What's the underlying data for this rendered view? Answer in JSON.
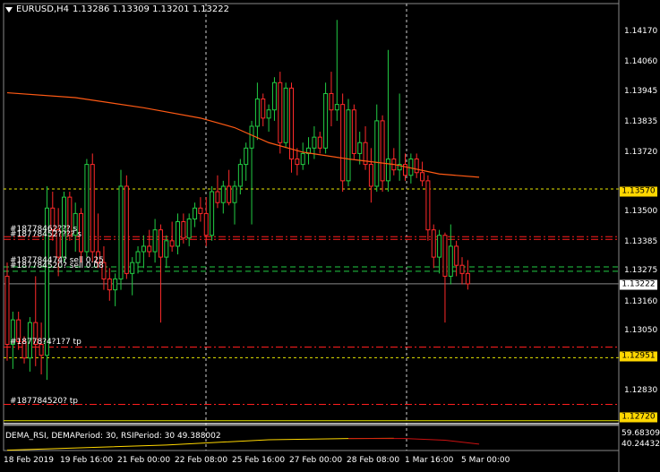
{
  "header": {
    "symbol_timeframe": "EURUSD,H4",
    "ohlc": "1.13286 1.13309 1.13201 1.13222"
  },
  "colors": {
    "background": "#000000",
    "grid": "#3c3c3c",
    "bull_candle": "#22cc44",
    "bear_candle": "#ff2a2a",
    "ma_line": "#ff5a14",
    "bid_line": "#888888",
    "tp_line": "#ff1e1e",
    "entry_line": "#22cc44",
    "level_line": "#e8e800",
    "rsi_yellow": "#ffd700",
    "rsi_red": "#cc1111"
  },
  "price_axis": {
    "ticks": [
      "1.14170",
      "1.14060",
      "1.13945",
      "1.13835",
      "1.13720",
      "1.13500",
      "1.13385",
      "1.13275",
      "1.13160",
      "1.13050",
      "1.12830"
    ],
    "current_price_tag": "1.13222",
    "level_tags": [
      "1.13570",
      "1.12951",
      "1.12720"
    ]
  },
  "orders": {
    "labels": [
      "#18778462??? s",
      "#18778452???? s",
      "#187784474? sell 0.25",
      "#187784520? sell 0.08",
      "#18778?4?1?7 tp",
      "#187784520? tp"
    ]
  },
  "time_axis": {
    "labels": [
      "18 Feb 2019",
      "19 Feb 16:00",
      "21 Feb 00:00",
      "22 Feb 08:00",
      "25 Feb 16:00",
      "27 Feb 00:00",
      "28 Feb 08:00",
      "1 Mar 16:00",
      "5 Mar 00:00"
    ]
  },
  "indicator": {
    "title": "DEMA_RSI, DEMAPeriod: 30, RSIPeriod: 30  49.388002",
    "ticks": [
      "59.683093",
      "40.244323"
    ]
  },
  "chart_data": {
    "type": "candlestick",
    "symbol": "EURUSD",
    "timeframe": "H4",
    "ylim": [
      1.12706,
      1.1425
    ],
    "ohlc": [
      {
        "o": 1.1325,
        "h": 1.133,
        "l": 1.1294,
        "c": 1.13
      },
      {
        "o": 1.13,
        "h": 1.1312,
        "l": 1.1291,
        "c": 1.1309
      },
      {
        "o": 1.1309,
        "h": 1.1312,
        "l": 1.1298,
        "c": 1.1301
      },
      {
        "o": 1.1301,
        "h": 1.1303,
        "l": 1.1293,
        "c": 1.1295
      },
      {
        "o": 1.1295,
        "h": 1.131,
        "l": 1.129,
        "c": 1.1308
      },
      {
        "o": 1.1308,
        "h": 1.1325,
        "l": 1.1292,
        "c": 1.13
      },
      {
        "o": 1.13,
        "h": 1.1308,
        "l": 1.1289,
        "c": 1.1296
      },
      {
        "o": 1.1296,
        "h": 1.1358,
        "l": 1.1287,
        "c": 1.135
      },
      {
        "o": 1.135,
        "h": 1.1356,
        "l": 1.1338,
        "c": 1.1342
      },
      {
        "o": 1.1342,
        "h": 1.135,
        "l": 1.1325,
        "c": 1.1332
      },
      {
        "o": 1.1332,
        "h": 1.1356,
        "l": 1.133,
        "c": 1.1354
      },
      {
        "o": 1.1354,
        "h": 1.1356,
        "l": 1.1338,
        "c": 1.134
      },
      {
        "o": 1.134,
        "h": 1.1352,
        "l": 1.1334,
        "c": 1.1348
      },
      {
        "o": 1.1348,
        "h": 1.135,
        "l": 1.133,
        "c": 1.1334
      },
      {
        "o": 1.1334,
        "h": 1.1368,
        "l": 1.1332,
        "c": 1.1366
      },
      {
        "o": 1.1366,
        "h": 1.137,
        "l": 1.133,
        "c": 1.1334
      },
      {
        "o": 1.1334,
        "h": 1.1348,
        "l": 1.1328,
        "c": 1.133
      },
      {
        "o": 1.133,
        "h": 1.1336,
        "l": 1.132,
        "c": 1.1324
      },
      {
        "o": 1.1324,
        "h": 1.1328,
        "l": 1.1316,
        "c": 1.132
      },
      {
        "o": 1.132,
        "h": 1.1326,
        "l": 1.1314,
        "c": 1.1324
      },
      {
        "o": 1.1324,
        "h": 1.1364,
        "l": 1.132,
        "c": 1.1358
      },
      {
        "o": 1.1358,
        "h": 1.1362,
        "l": 1.1324,
        "c": 1.1326
      },
      {
        "o": 1.1326,
        "h": 1.1332,
        "l": 1.1318,
        "c": 1.133
      },
      {
        "o": 1.133,
        "h": 1.1336,
        "l": 1.1326,
        "c": 1.1334
      },
      {
        "o": 1.1334,
        "h": 1.134,
        "l": 1.1328,
        "c": 1.1336
      },
      {
        "o": 1.1336,
        "h": 1.1342,
        "l": 1.1332,
        "c": 1.1334
      },
      {
        "o": 1.1334,
        "h": 1.1346,
        "l": 1.133,
        "c": 1.1342
      },
      {
        "o": 1.1342,
        "h": 1.1344,
        "l": 1.1308,
        "c": 1.1332
      },
      {
        "o": 1.1332,
        "h": 1.134,
        "l": 1.1328,
        "c": 1.1338
      },
      {
        "o": 1.1338,
        "h": 1.1345,
        "l": 1.1334,
        "c": 1.1336
      },
      {
        "o": 1.1336,
        "h": 1.1348,
        "l": 1.1333,
        "c": 1.1345
      },
      {
        "o": 1.1345,
        "h": 1.1348,
        "l": 1.1337,
        "c": 1.1339
      },
      {
        "o": 1.1339,
        "h": 1.1348,
        "l": 1.1336,
        "c": 1.1346
      },
      {
        "o": 1.1346,
        "h": 1.1352,
        "l": 1.1343,
        "c": 1.135
      },
      {
        "o": 1.135,
        "h": 1.1354,
        "l": 1.1345,
        "c": 1.1348
      },
      {
        "o": 1.1348,
        "h": 1.1354,
        "l": 1.1336,
        "c": 1.134
      },
      {
        "o": 1.134,
        "h": 1.1358,
        "l": 1.1338,
        "c": 1.1356
      },
      {
        "o": 1.1356,
        "h": 1.1362,
        "l": 1.135,
        "c": 1.1352
      },
      {
        "o": 1.1352,
        "h": 1.136,
        "l": 1.1348,
        "c": 1.1358
      },
      {
        "o": 1.1358,
        "h": 1.1364,
        "l": 1.1351,
        "c": 1.1352
      },
      {
        "o": 1.1352,
        "h": 1.136,
        "l": 1.1344,
        "c": 1.1358
      },
      {
        "o": 1.1358,
        "h": 1.1368,
        "l": 1.1355,
        "c": 1.1366
      },
      {
        "o": 1.1366,
        "h": 1.1374,
        "l": 1.136,
        "c": 1.1372
      },
      {
        "o": 1.1372,
        "h": 1.1382,
        "l": 1.1344,
        "c": 1.138
      },
      {
        "o": 1.138,
        "h": 1.1396,
        "l": 1.1375,
        "c": 1.139
      },
      {
        "o": 1.139,
        "h": 1.1392,
        "l": 1.138,
        "c": 1.1383
      },
      {
        "o": 1.1383,
        "h": 1.1388,
        "l": 1.1378,
        "c": 1.1386
      },
      {
        "o": 1.1386,
        "h": 1.1398,
        "l": 1.1382,
        "c": 1.1396
      },
      {
        "o": 1.1396,
        "h": 1.14,
        "l": 1.137,
        "c": 1.1374
      },
      {
        "o": 1.1374,
        "h": 1.1396,
        "l": 1.1372,
        "c": 1.1394
      },
      {
        "o": 1.1394,
        "h": 1.1396,
        "l": 1.1363,
        "c": 1.1368
      },
      {
        "o": 1.1368,
        "h": 1.1372,
        "l": 1.1362,
        "c": 1.1366
      },
      {
        "o": 1.1366,
        "h": 1.1374,
        "l": 1.1364,
        "c": 1.137
      },
      {
        "o": 1.137,
        "h": 1.1376,
        "l": 1.1366,
        "c": 1.1372
      },
      {
        "o": 1.1372,
        "h": 1.138,
        "l": 1.1368,
        "c": 1.1376
      },
      {
        "o": 1.1376,
        "h": 1.1378,
        "l": 1.137,
        "c": 1.1372
      },
      {
        "o": 1.1372,
        "h": 1.1396,
        "l": 1.137,
        "c": 1.1392
      },
      {
        "o": 1.1392,
        "h": 1.14,
        "l": 1.138,
        "c": 1.1386
      },
      {
        "o": 1.1386,
        "h": 1.1419,
        "l": 1.1382,
        "c": 1.1388
      },
      {
        "o": 1.1388,
        "h": 1.1392,
        "l": 1.1356,
        "c": 1.136
      },
      {
        "o": 1.136,
        "h": 1.139,
        "l": 1.1358,
        "c": 1.1386
      },
      {
        "o": 1.1386,
        "h": 1.1388,
        "l": 1.1368,
        "c": 1.137
      },
      {
        "o": 1.137,
        "h": 1.1378,
        "l": 1.1366,
        "c": 1.1374
      },
      {
        "o": 1.1374,
        "h": 1.138,
        "l": 1.1364,
        "c": 1.1366
      },
      {
        "o": 1.1366,
        "h": 1.1372,
        "l": 1.1352,
        "c": 1.1358
      },
      {
        "o": 1.1358,
        "h": 1.1388,
        "l": 1.1356,
        "c": 1.1382
      },
      {
        "o": 1.1382,
        "h": 1.1384,
        "l": 1.1356,
        "c": 1.136
      },
      {
        "o": 1.136,
        "h": 1.1408,
        "l": 1.1356,
        "c": 1.1368
      },
      {
        "o": 1.1368,
        "h": 1.1372,
        "l": 1.1362,
        "c": 1.1364
      },
      {
        "o": 1.1364,
        "h": 1.1392,
        "l": 1.136,
        "c": 1.1366
      },
      {
        "o": 1.1366,
        "h": 1.137,
        "l": 1.136,
        "c": 1.1362
      },
      {
        "o": 1.1362,
        "h": 1.137,
        "l": 1.1359,
        "c": 1.1368
      },
      {
        "o": 1.1368,
        "h": 1.137,
        "l": 1.1361,
        "c": 1.1363
      },
      {
        "o": 1.1363,
        "h": 1.1367,
        "l": 1.1358,
        "c": 1.136
      },
      {
        "o": 1.136,
        "h": 1.1362,
        "l": 1.1338,
        "c": 1.1342
      },
      {
        "o": 1.1342,
        "h": 1.1344,
        "l": 1.1328,
        "c": 1.1332
      },
      {
        "o": 1.1332,
        "h": 1.1342,
        "l": 1.1326,
        "c": 1.134
      },
      {
        "o": 1.134,
        "h": 1.1341,
        "l": 1.1308,
        "c": 1.1325
      },
      {
        "o": 1.1325,
        "h": 1.1344,
        "l": 1.1322,
        "c": 1.1336
      },
      {
        "o": 1.1336,
        "h": 1.1338,
        "l": 1.1325,
        "c": 1.1329
      },
      {
        "o": 1.1329,
        "h": 1.1332,
        "l": 1.1322,
        "c": 1.1326
      },
      {
        "o": 1.1326,
        "h": 1.13309,
        "l": 1.13201,
        "c": 1.13222
      }
    ],
    "moving_average": [
      {
        "i": 0,
        "v": 1.13923
      },
      {
        "i": 12,
        "v": 1.13905
      },
      {
        "i": 24,
        "v": 1.13868
      },
      {
        "i": 34,
        "v": 1.1383
      },
      {
        "i": 40,
        "v": 1.13795
      },
      {
        "i": 46,
        "v": 1.1374
      },
      {
        "i": 52,
        "v": 1.13705
      },
      {
        "i": 60,
        "v": 1.1368
      },
      {
        "i": 68,
        "v": 1.1366
      },
      {
        "i": 76,
        "v": 1.13625
      },
      {
        "i": 83,
        "v": 1.13613
      }
    ],
    "levels": {
      "bid": 1.13222,
      "yellow_dashed": [
        1.1357,
        1.12951
      ],
      "yellow_solid": 1.1272,
      "red_dash_dot": [
        1.13395,
        1.13385,
        1.1299,
        1.1278
      ],
      "green_dashed": [
        1.13284,
        1.13268
      ]
    },
    "indicator_series": {
      "ylim": [
        40.244323,
        59.683093
      ],
      "yellow": [
        {
          "i": 0,
          "v": 40.5
        },
        {
          "i": 28,
          "v": 44.5
        },
        {
          "i": 46,
          "v": 48.6
        },
        {
          "i": 60,
          "v": 49.5
        },
        {
          "i": 68,
          "v": 49.7
        }
      ],
      "red": [
        {
          "i": 60,
          "v": 49.5
        },
        {
          "i": 70,
          "v": 49.5
        },
        {
          "i": 77,
          "v": 48.2
        },
        {
          "i": 83,
          "v": 45.2
        }
      ]
    }
  }
}
